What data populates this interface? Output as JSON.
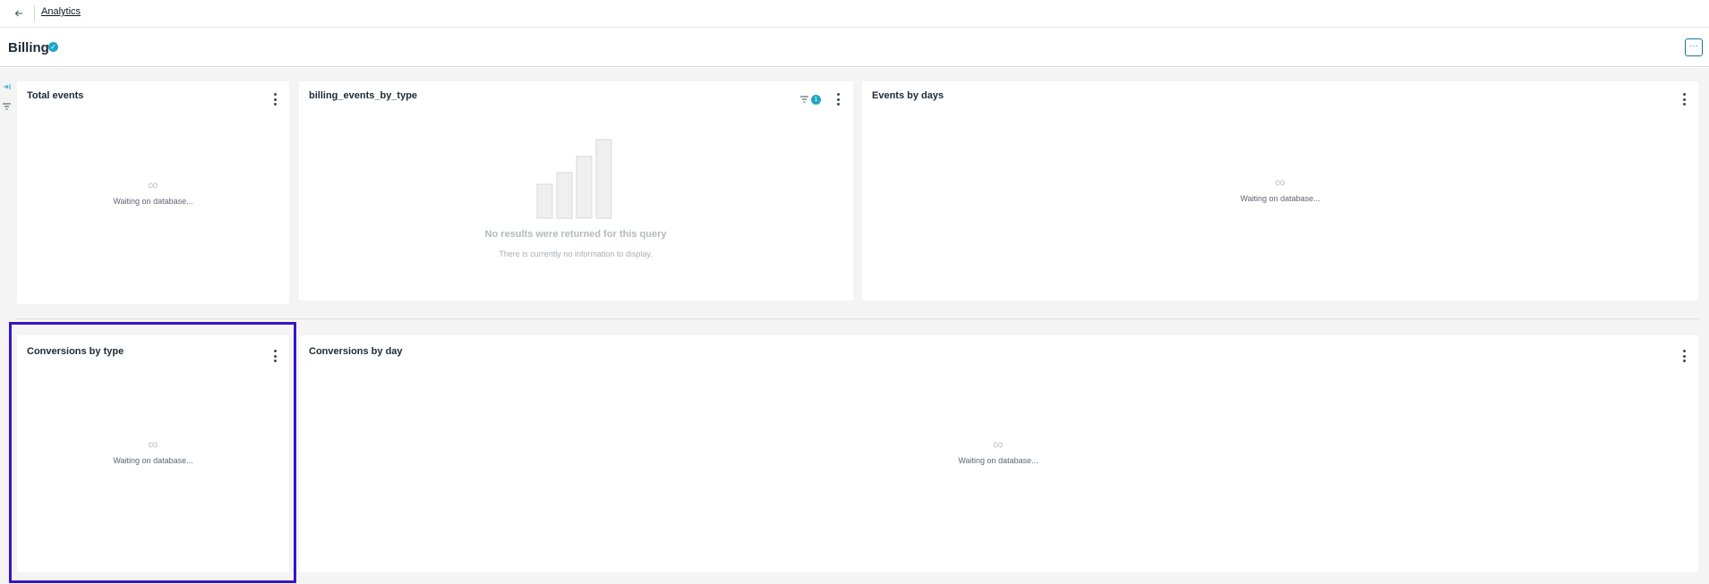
{
  "topbar": {
    "back_icon": "arrow-left-icon",
    "breadcrumb": "Analytics"
  },
  "header": {
    "title": "Billing",
    "verified_icon": "verified-check-icon",
    "more_label": "···"
  },
  "cards": {
    "total_events": {
      "title": "Total events",
      "status": "Waiting on database..."
    },
    "billing_events_by_type": {
      "title": "billing_events_by_type",
      "filter_count": "1",
      "empty_title": "No results were returned for this query",
      "empty_sub": "There is currently no information to display."
    },
    "events_by_days": {
      "title": "Events by days",
      "status": "Waiting on database..."
    },
    "conversions_by_type": {
      "title": "Conversions by type",
      "status": "Waiting on database..."
    },
    "conversions_by_day": {
      "title": "Conversions by day",
      "status": "Waiting on database..."
    }
  },
  "loading_glyph": "∞",
  "colors": {
    "accent": "#1fa6c9",
    "selection": "#3a13c5",
    "canvas": "#f4f4f5"
  }
}
